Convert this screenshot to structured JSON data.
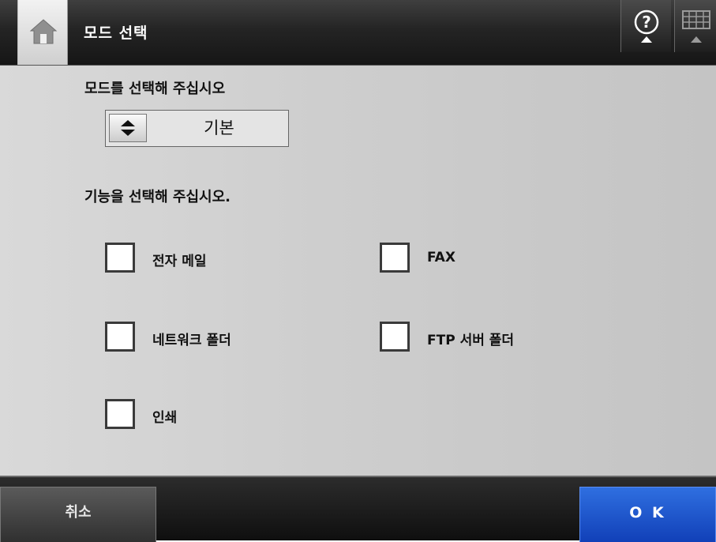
{
  "header": {
    "title": "모드 선택",
    "home_icon": "home-icon",
    "help_icon": "help-icon",
    "keyboard_icon": "keyboard-icon"
  },
  "main": {
    "mode_prompt": "모드를 선택해 주십시오",
    "mode_select": {
      "value": "기본",
      "icon": "up-down-arrow-icon"
    },
    "function_prompt": "기능을 선택해 주십시오.",
    "options": [
      {
        "label": "전자 메일",
        "checked": false
      },
      {
        "label": "FAX",
        "checked": false
      },
      {
        "label": "네트워크 폴더",
        "checked": false
      },
      {
        "label": "FTP 서버 폴더",
        "checked": false
      },
      {
        "label": "인쇄",
        "checked": false
      }
    ]
  },
  "footer": {
    "cancel_label": "취소",
    "ok_label": "O K"
  },
  "colors": {
    "ok_button": "#1a4fd0",
    "header_bg": "#222222",
    "content_bg": "#d0d0d0"
  }
}
